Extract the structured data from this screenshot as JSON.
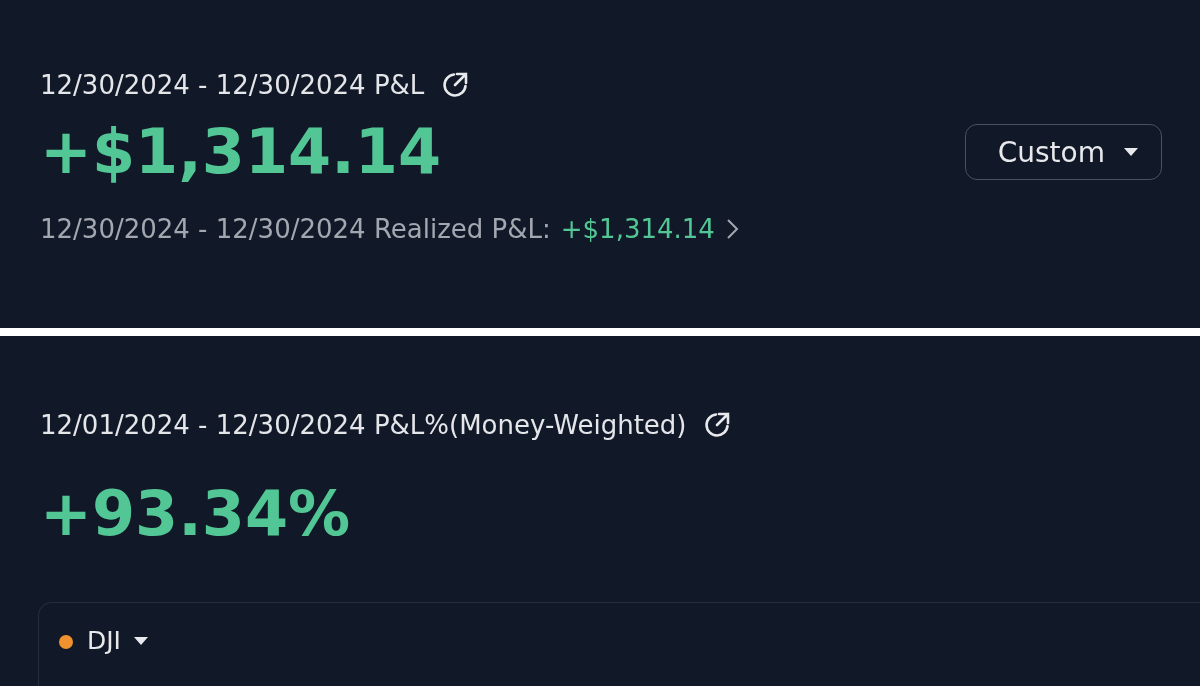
{
  "pnl_panel": {
    "title": "12/30/2024 - 12/30/2024 P&L",
    "value": "+$1,314.14",
    "range_dropdown": {
      "label": "Custom"
    },
    "realized": {
      "label": "12/30/2024 - 12/30/2024 Realized P&L:",
      "value": "+$1,314.14"
    }
  },
  "return_panel": {
    "title": "12/01/2024 - 12/30/2024 P&L%(Money-Weighted)",
    "value": "+93.34%",
    "benchmark": {
      "label": "DJI",
      "color": "#f0922e"
    }
  }
}
